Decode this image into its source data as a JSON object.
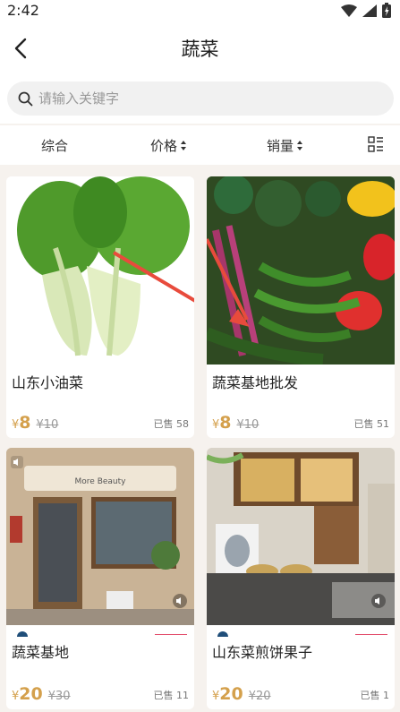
{
  "status": {
    "time": "2:42"
  },
  "header": {
    "title": "蔬菜"
  },
  "search": {
    "placeholder": "请输入关键字"
  },
  "filters": [
    {
      "label": "综合"
    },
    {
      "label": "价格"
    },
    {
      "label": "销量"
    }
  ],
  "products": [
    {
      "name": "山东小油菜",
      "currency": "¥",
      "price": "8",
      "original_price": "¥10",
      "sold": "已售 58"
    },
    {
      "name": "蔬菜基地批发",
      "currency": "¥",
      "price": "8",
      "original_price": "¥10",
      "sold": "已售 51"
    },
    {
      "name": "蔬菜基地",
      "currency": "¥",
      "price": "20",
      "original_price": "¥30",
      "sold": "已售 11"
    },
    {
      "name": "山东菜煎饼果子",
      "currency": "¥",
      "price": "20",
      "original_price": "¥20",
      "sold": "已售 1"
    }
  ],
  "image_texts": {
    "shop_sign": "More Beauty"
  },
  "colors": {
    "price": "#d4a04c",
    "background": "#f6f2ee",
    "accent_line": "#e24b6a"
  }
}
